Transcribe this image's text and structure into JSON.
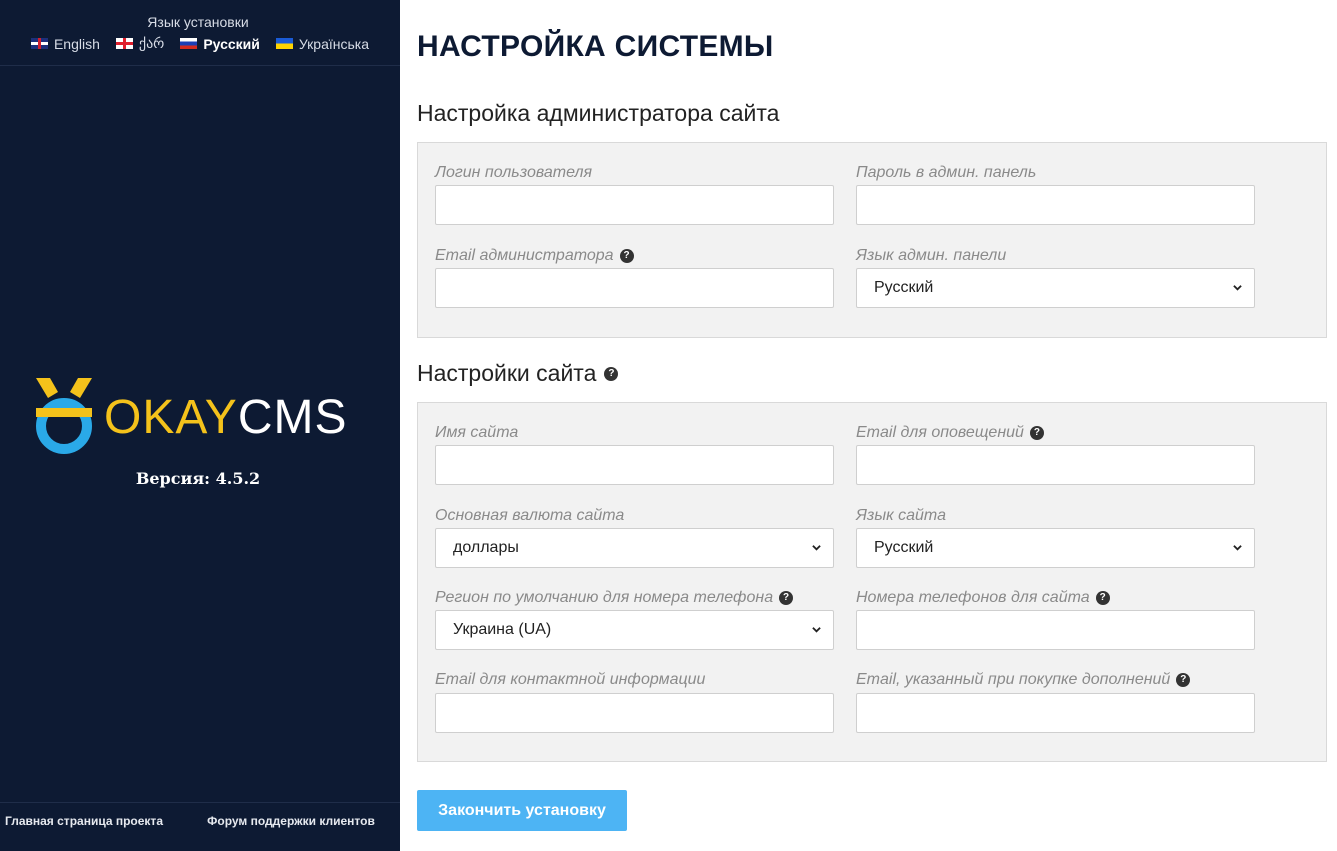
{
  "sidebar": {
    "lang_title": "Язык установки",
    "languages": [
      {
        "label": "English",
        "flag": "uk-flag-icon",
        "active": false
      },
      {
        "label": "ქარ",
        "flag": "georgia-flag-icon",
        "active": false
      },
      {
        "label": "Русский",
        "flag": "russia-flag-icon",
        "active": true
      },
      {
        "label": "Українська",
        "flag": "ukraine-flag-icon",
        "active": false
      }
    ],
    "logo": {
      "okay": "OKAY",
      "cms": "CMS"
    },
    "version": "Версия: 4.5.2",
    "footer": {
      "home_link": "Главная страница проекта",
      "forum_link": "Форум поддержки клиентов"
    }
  },
  "main": {
    "title": "НАСТРОЙКА СИСТЕМЫ",
    "admin_section": {
      "title": "Настройка администратора сайта",
      "login_label": "Логин пользователя",
      "login_value": "",
      "password_label": "Пароль в админ. панель",
      "password_value": "",
      "email_label": "Email администратора",
      "email_value": "",
      "admin_lang_label": "Язык админ. панели",
      "admin_lang_value": "Русский"
    },
    "site_section": {
      "title": "Настройки сайта",
      "site_name_label": "Имя сайта",
      "site_name_value": "",
      "notify_email_label": "Email для оповещений",
      "notify_email_value": "",
      "currency_label": "Основная валюта сайта",
      "currency_value": "доллары",
      "site_lang_label": "Язык сайта",
      "site_lang_value": "Русский",
      "phone_region_label": "Регион по умолчанию для номера телефона",
      "phone_region_value": "Украина (UA)",
      "phones_label": "Номера телефонов для сайта",
      "phones_value": "",
      "contact_email_label": "Email для контактной информации",
      "contact_email_value": "",
      "purchase_email_label": "Email, указанный при покупке дополнений",
      "purchase_email_value": ""
    },
    "submit_label": "Закончить установку"
  },
  "colors": {
    "sidebar_bg": "#0d1a33",
    "accent_yellow": "#f4c21b",
    "accent_blue": "#2aa9e8",
    "button_bg": "#4db4f4"
  }
}
